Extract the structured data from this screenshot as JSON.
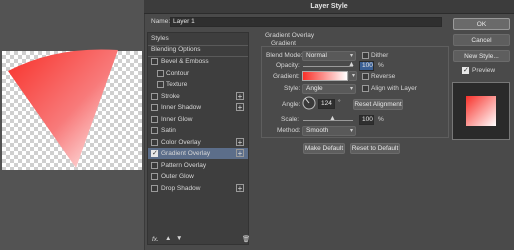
{
  "dialog": {
    "title": "Layer Style"
  },
  "name_field": {
    "label": "Name:",
    "value": "Layer 1"
  },
  "styles_list": {
    "header": "Styles",
    "blending": "Blending Options",
    "items": [
      {
        "label": "Bevel & Emboss",
        "checked": false,
        "plus": false,
        "indent": false
      },
      {
        "label": "Contour",
        "checked": false,
        "plus": false,
        "indent": true
      },
      {
        "label": "Texture",
        "checked": false,
        "plus": false,
        "indent": true
      },
      {
        "label": "Stroke",
        "checked": false,
        "plus": true,
        "indent": false
      },
      {
        "label": "Inner Shadow",
        "checked": false,
        "plus": true,
        "indent": false
      },
      {
        "label": "Inner Glow",
        "checked": false,
        "plus": false,
        "indent": false
      },
      {
        "label": "Satin",
        "checked": false,
        "plus": false,
        "indent": false
      },
      {
        "label": "Color Overlay",
        "checked": false,
        "plus": true,
        "indent": false
      },
      {
        "label": "Gradient Overlay",
        "checked": true,
        "plus": true,
        "indent": false,
        "selected": true
      },
      {
        "label": "Pattern Overlay",
        "checked": false,
        "plus": false,
        "indent": false
      },
      {
        "label": "Outer Glow",
        "checked": false,
        "plus": false,
        "indent": false
      },
      {
        "label": "Drop Shadow",
        "checked": false,
        "plus": true,
        "indent": false
      }
    ],
    "footer_icons": [
      "fx-icon",
      "move-up-icon",
      "move-down-icon",
      "trash-icon"
    ],
    "fx_label": "fx."
  },
  "gradient_overlay": {
    "section_title": "Gradient Overlay",
    "subsection": "Gradient",
    "blend_mode": {
      "label": "Blend Mode:",
      "value": "Normal"
    },
    "dither": {
      "label": "Dither",
      "checked": false
    },
    "opacity": {
      "label": "Opacity:",
      "value": "100",
      "unit": "%"
    },
    "gradient": {
      "label": "Gradient:",
      "from": "#f8312a",
      "to": "#ffffff"
    },
    "reverse": {
      "label": "Reverse",
      "checked": false
    },
    "style": {
      "label": "Style:",
      "value": "Angle"
    },
    "align": {
      "label": "Align with Layer",
      "checked": false
    },
    "angle": {
      "label": "Angle:",
      "value": "124",
      "unit": "°"
    },
    "reset_alignment": "Reset Alignment",
    "scale": {
      "label": "Scale:",
      "value": "100",
      "unit": "%"
    },
    "method": {
      "label": "Method:",
      "value": "Smooth"
    },
    "make_default": "Make Default",
    "reset_default": "Reset to Default"
  },
  "buttons": {
    "ok": "OK",
    "cancel": "Cancel",
    "new_style": "New Style...",
    "preview": "Preview",
    "preview_checked": true
  }
}
